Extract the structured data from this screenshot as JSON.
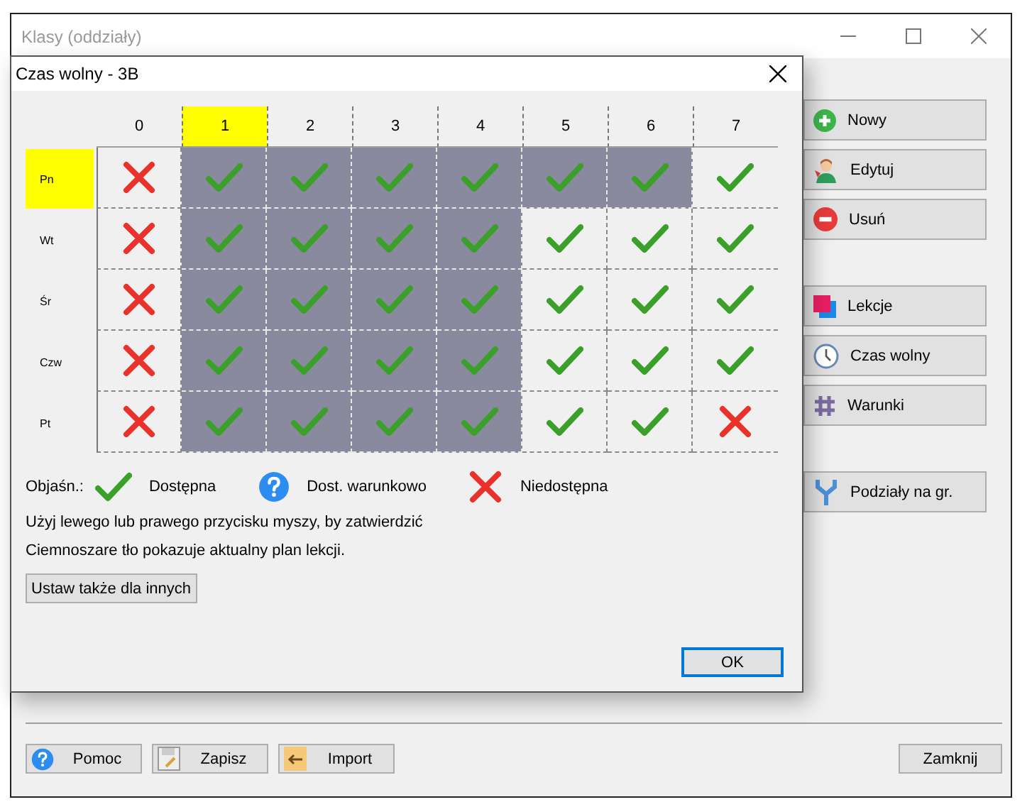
{
  "window": {
    "title": "Klasy (oddziały)"
  },
  "dialog": {
    "title": "Czas wolny - 3B",
    "columns": [
      {
        "label": "0",
        "selected": false
      },
      {
        "label": "1",
        "selected": true
      },
      {
        "label": "2",
        "selected": false
      },
      {
        "label": "3",
        "selected": false
      },
      {
        "label": "4",
        "selected": false
      },
      {
        "label": "5",
        "selected": false
      },
      {
        "label": "6",
        "selected": false
      },
      {
        "label": "7",
        "selected": false
      }
    ],
    "rows": [
      {
        "label": "Pn",
        "selected": true,
        "cells": [
          {
            "kind": "unavailable",
            "current": false
          },
          {
            "kind": "available",
            "current": true
          },
          {
            "kind": "available",
            "current": true
          },
          {
            "kind": "available",
            "current": true
          },
          {
            "kind": "available",
            "current": true
          },
          {
            "kind": "available",
            "current": true
          },
          {
            "kind": "available",
            "current": true
          },
          {
            "kind": "available",
            "current": false
          }
        ]
      },
      {
        "label": "Wt",
        "selected": false,
        "cells": [
          {
            "kind": "unavailable",
            "current": false
          },
          {
            "kind": "available",
            "current": true
          },
          {
            "kind": "available",
            "current": true
          },
          {
            "kind": "available",
            "current": true
          },
          {
            "kind": "available",
            "current": true
          },
          {
            "kind": "available",
            "current": false
          },
          {
            "kind": "available",
            "current": false
          },
          {
            "kind": "available",
            "current": false
          }
        ]
      },
      {
        "label": "Śr",
        "selected": false,
        "cells": [
          {
            "kind": "unavailable",
            "current": false
          },
          {
            "kind": "available",
            "current": true
          },
          {
            "kind": "available",
            "current": true
          },
          {
            "kind": "available",
            "current": true
          },
          {
            "kind": "available",
            "current": true
          },
          {
            "kind": "available",
            "current": false
          },
          {
            "kind": "available",
            "current": false
          },
          {
            "kind": "available",
            "current": false
          }
        ]
      },
      {
        "label": "Czw",
        "selected": false,
        "cells": [
          {
            "kind": "unavailable",
            "current": false
          },
          {
            "kind": "available",
            "current": true
          },
          {
            "kind": "available",
            "current": true
          },
          {
            "kind": "available",
            "current": true
          },
          {
            "kind": "available",
            "current": true
          },
          {
            "kind": "available",
            "current": false
          },
          {
            "kind": "available",
            "current": false
          },
          {
            "kind": "available",
            "current": false
          }
        ]
      },
      {
        "label": "Pt",
        "selected": false,
        "cells": [
          {
            "kind": "unavailable",
            "current": false
          },
          {
            "kind": "available",
            "current": true
          },
          {
            "kind": "available",
            "current": true
          },
          {
            "kind": "available",
            "current": true
          },
          {
            "kind": "available",
            "current": true
          },
          {
            "kind": "available",
            "current": false
          },
          {
            "kind": "available",
            "current": false
          },
          {
            "kind": "unavailable",
            "current": false
          }
        ]
      }
    ],
    "legend": {
      "label": "Objaśn.:",
      "items": [
        {
          "kind": "available",
          "label": "Dostępna"
        },
        {
          "kind": "conditional",
          "label": "Dost. warunkowo"
        },
        {
          "kind": "unavailable",
          "label": "Niedostępna"
        }
      ]
    },
    "notes": [
      "Użyj lewego lub prawego przycisku myszy, by zatwierdzić",
      "Ciemnoszare tło pokazuje aktualny plan lekcji."
    ],
    "apply_button": "Ustaw także dla innych",
    "ok_button": "OK"
  },
  "side_groups": [
    [
      {
        "kind": "add",
        "label": "Nowy"
      },
      {
        "kind": "edit",
        "label": "Edytuj"
      },
      {
        "kind": "remove",
        "label": "Usuń"
      }
    ],
    [
      {
        "kind": "lessons",
        "label": "Lekcje"
      },
      {
        "kind": "clock",
        "label": "Czas wolny"
      },
      {
        "kind": "hash",
        "label": "Warunki"
      }
    ],
    [
      {
        "kind": "split",
        "label": "Podziały na gr."
      }
    ]
  ],
  "footer": {
    "buttons": [
      {
        "kind": "help",
        "label": "Pomoc"
      },
      {
        "kind": "save",
        "label": "Zapisz"
      },
      {
        "kind": "import",
        "label": "Import"
      }
    ],
    "close_button": "Zamknij"
  }
}
